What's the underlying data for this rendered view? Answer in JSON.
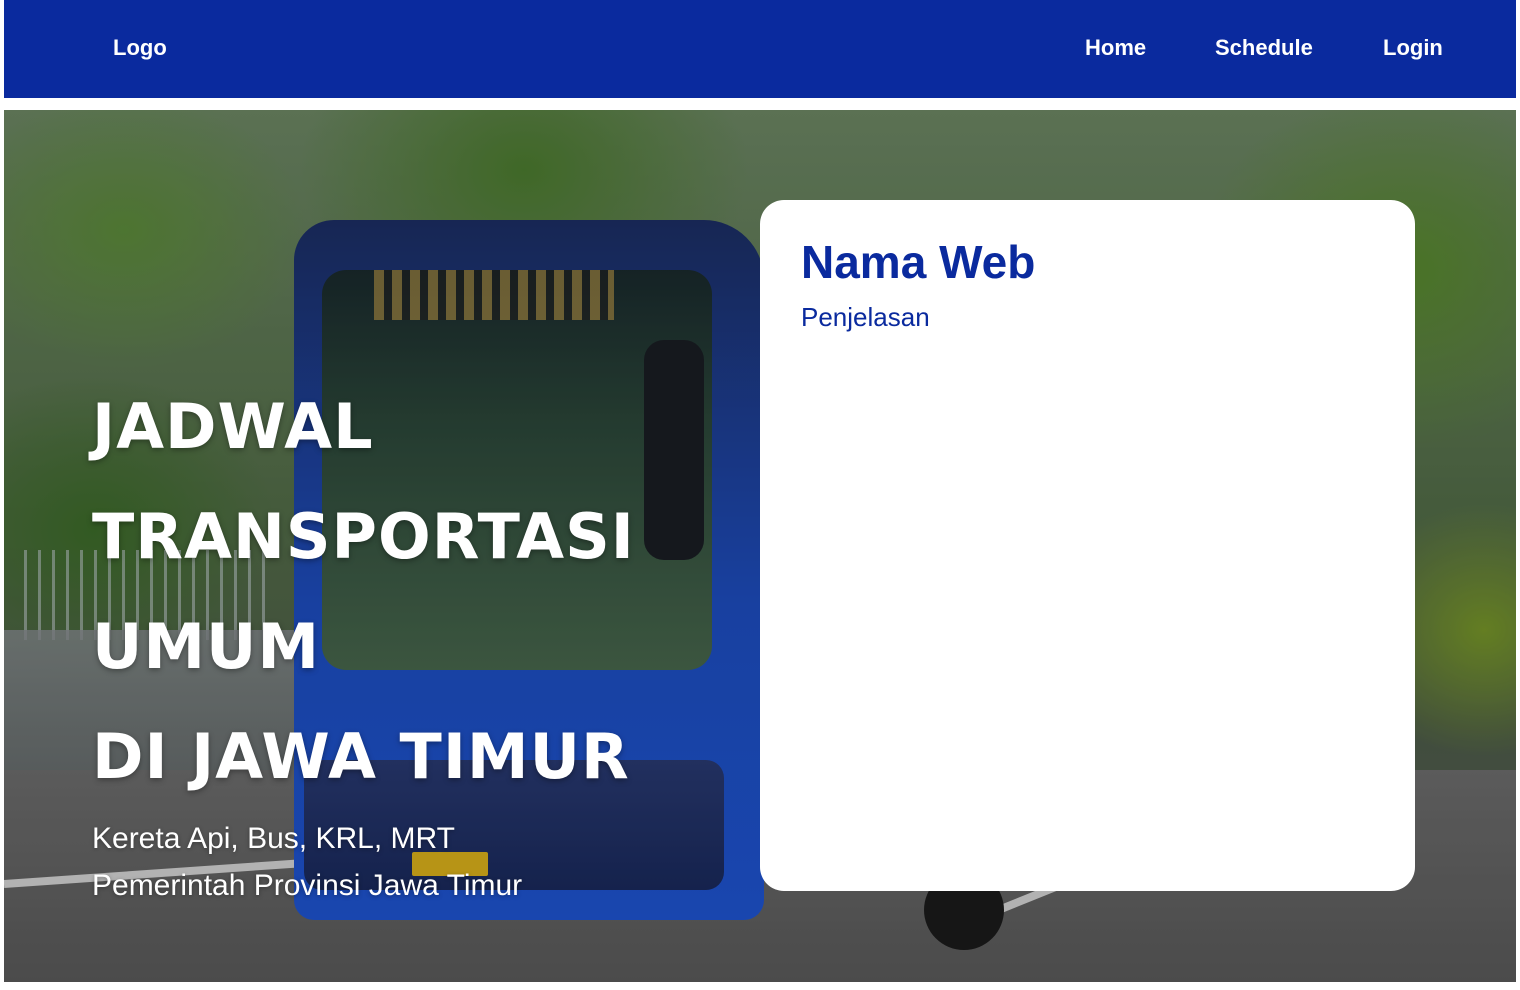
{
  "nav": {
    "logo": "Logo",
    "links": [
      "Home",
      "Schedule",
      "Login"
    ]
  },
  "hero": {
    "title_lines": [
      "JADWAL",
      "TRANSPORTASI",
      "UMUM",
      "DI JAWA TIMUR"
    ],
    "subtitle_lines": [
      "Kereta Api, Bus, KRL, MRT",
      "Pemerintah Provinsi Jawa Timur"
    ],
    "background_image": "blue-city-bus-photo"
  },
  "card": {
    "title": "Nama Web",
    "description": "Penjelasan"
  },
  "colors": {
    "primary": "#0a2a9e",
    "text_on_primary": "#ffffff",
    "card_background": "#ffffff"
  }
}
